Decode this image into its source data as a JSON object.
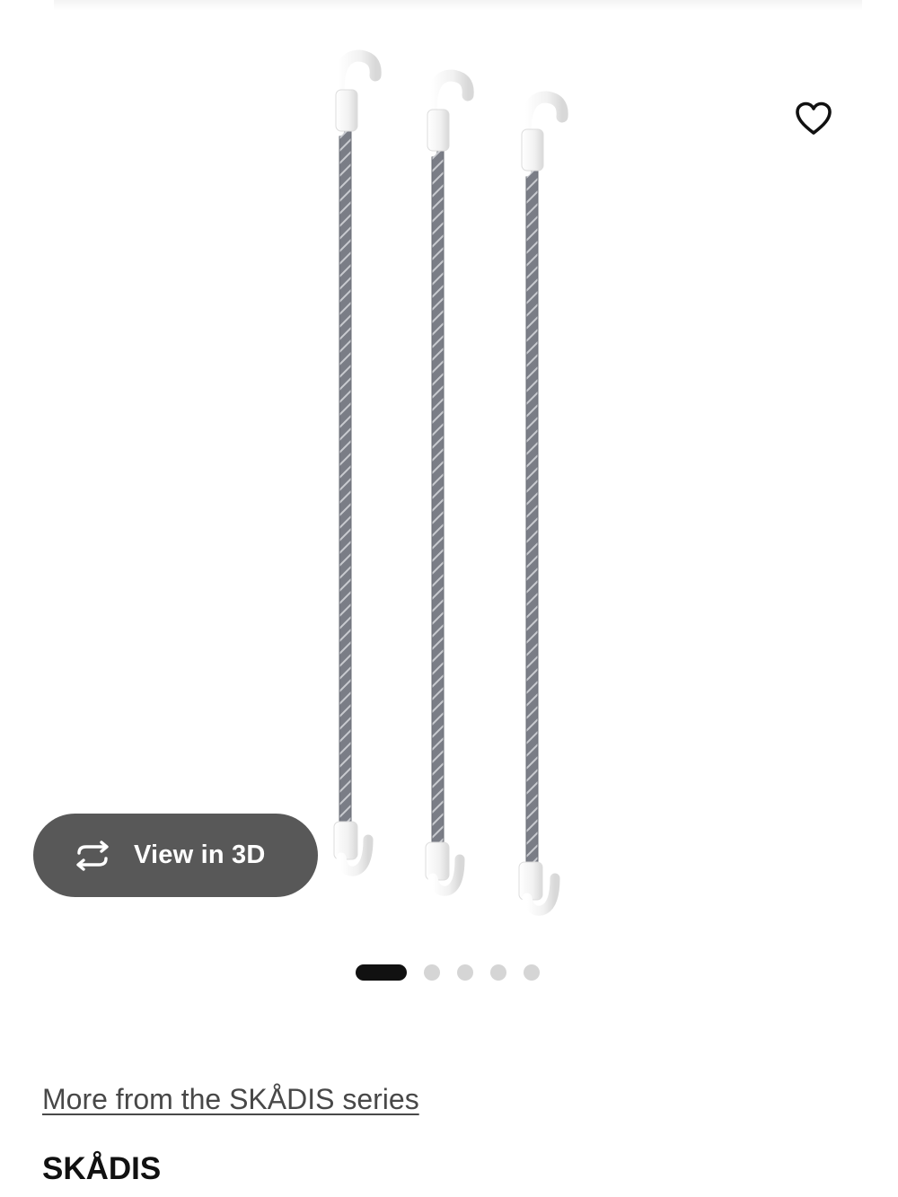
{
  "gallery": {
    "image_alt": "SKÅDIS hooks with elastic cords",
    "view3d_label": "View in 3D",
    "favourite_icon": "heart-outline-icon",
    "view3d_icon": "rotate-3d-icon",
    "slide_count": 5,
    "active_slide": 1
  },
  "product": {
    "series_link_text": "More from the SKÅDIS series",
    "name": "SKÅDIS"
  },
  "colors": {
    "pill_background": "#585858",
    "active_dot": "#111111",
    "inactive_dot": "#d5d5d5",
    "cord": "#7a7d86",
    "hook": "#f2f2f2"
  }
}
